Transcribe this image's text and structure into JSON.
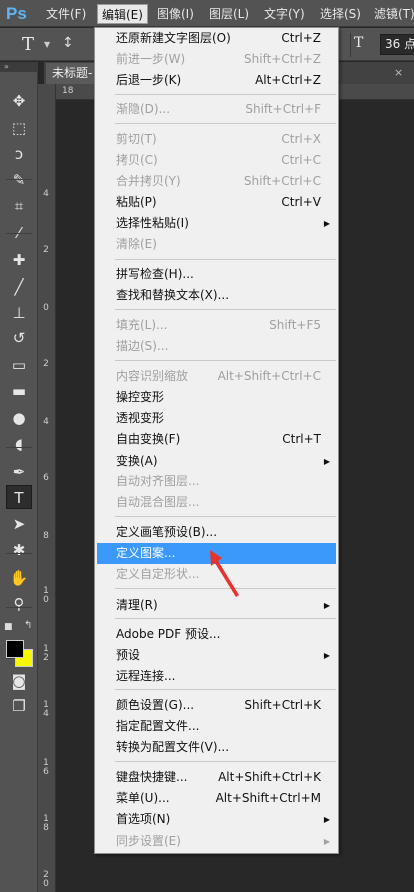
{
  "app": {
    "logo": "Ps"
  },
  "menubar": {
    "items": [
      {
        "label": "文件(F)"
      },
      {
        "label": "编辑(E)"
      },
      {
        "label": "图像(I)"
      },
      {
        "label": "图层(L)"
      },
      {
        "label": "文字(Y)"
      },
      {
        "label": "选择(S)"
      },
      {
        "label": "滤镜(T)"
      }
    ],
    "active_index": 1
  },
  "options_bar": {
    "tool_glyph": "T",
    "font_size_glyph": "T",
    "font_size_value": "36 点"
  },
  "document": {
    "tab_title": "未标题-",
    "tab_close": "×"
  },
  "rulers": {
    "horizontal": [
      "18"
    ],
    "vertical": [
      "4",
      "2",
      "0",
      "2",
      "4",
      "6",
      "8",
      "1 0",
      "1 2",
      "1 4",
      "1 6",
      "1 8",
      "2 0"
    ]
  },
  "colors": {
    "foreground": "#000000",
    "background": "#f7f700",
    "menu_highlight": "#3b99fc",
    "annotation": "#e8322f"
  },
  "edit_menu": {
    "items": [
      {
        "label": "还原新建文字图层(O)",
        "shortcut": "Ctrl+Z",
        "enabled": true,
        "submenu": false
      },
      {
        "label": "前进一步(W)",
        "shortcut": "Shift+Ctrl+Z",
        "enabled": false,
        "submenu": false
      },
      {
        "label": "后退一步(K)",
        "shortcut": "Alt+Ctrl+Z",
        "enabled": true,
        "submenu": false
      },
      {
        "label": "渐隐(D)...",
        "shortcut": "Shift+Ctrl+F",
        "enabled": false,
        "submenu": false
      },
      {
        "label": "剪切(T)",
        "shortcut": "Ctrl+X",
        "enabled": false,
        "submenu": false
      },
      {
        "label": "拷贝(C)",
        "shortcut": "Ctrl+C",
        "enabled": false,
        "submenu": false
      },
      {
        "label": "合并拷贝(Y)",
        "shortcut": "Shift+Ctrl+C",
        "enabled": false,
        "submenu": false
      },
      {
        "label": "粘贴(P)",
        "shortcut": "Ctrl+V",
        "enabled": true,
        "submenu": false
      },
      {
        "label": "选择性粘贴(I)",
        "shortcut": "",
        "enabled": true,
        "submenu": true
      },
      {
        "label": "清除(E)",
        "shortcut": "",
        "enabled": false,
        "submenu": false
      },
      {
        "label": "拼写检查(H)...",
        "shortcut": "",
        "enabled": true,
        "submenu": false
      },
      {
        "label": "查找和替换文本(X)...",
        "shortcut": "",
        "enabled": true,
        "submenu": false
      },
      {
        "label": "填充(L)...",
        "shortcut": "Shift+F5",
        "enabled": false,
        "submenu": false
      },
      {
        "label": "描边(S)...",
        "shortcut": "",
        "enabled": false,
        "submenu": false
      },
      {
        "label": "内容识别缩放",
        "shortcut": "Alt+Shift+Ctrl+C",
        "enabled": false,
        "submenu": false
      },
      {
        "label": "操控变形",
        "shortcut": "",
        "enabled": true,
        "submenu": false
      },
      {
        "label": "透视变形",
        "shortcut": "",
        "enabled": true,
        "submenu": false
      },
      {
        "label": "自由变换(F)",
        "shortcut": "Ctrl+T",
        "enabled": true,
        "submenu": false
      },
      {
        "label": "变换(A)",
        "shortcut": "",
        "enabled": true,
        "submenu": true
      },
      {
        "label": "自动对齐图层...",
        "shortcut": "",
        "enabled": false,
        "submenu": false
      },
      {
        "label": "自动混合图层...",
        "shortcut": "",
        "enabled": false,
        "submenu": false
      },
      {
        "label": "定义画笔预设(B)...",
        "shortcut": "",
        "enabled": true,
        "submenu": false
      },
      {
        "label": "定义图案...",
        "shortcut": "",
        "enabled": true,
        "submenu": false,
        "hover": true
      },
      {
        "label": "定义自定形状...",
        "shortcut": "",
        "enabled": false,
        "submenu": false
      },
      {
        "label": "清理(R)",
        "shortcut": "",
        "enabled": true,
        "submenu": true
      },
      {
        "label": "Adobe PDF 预设...",
        "shortcut": "",
        "enabled": true,
        "submenu": false
      },
      {
        "label": "预设",
        "shortcut": "",
        "enabled": true,
        "submenu": true
      },
      {
        "label": "远程连接...",
        "shortcut": "",
        "enabled": true,
        "submenu": false
      },
      {
        "label": "颜色设置(G)...",
        "shortcut": "Shift+Ctrl+K",
        "enabled": true,
        "submenu": false
      },
      {
        "label": "指定配置文件...",
        "shortcut": "",
        "enabled": true,
        "submenu": false
      },
      {
        "label": "转换为配置文件(V)...",
        "shortcut": "",
        "enabled": true,
        "submenu": false
      },
      {
        "label": "键盘快捷键...",
        "shortcut": "Alt+Shift+Ctrl+K",
        "enabled": true,
        "submenu": false
      },
      {
        "label": "菜单(U)...",
        "shortcut": "Alt+Shift+Ctrl+M",
        "enabled": true,
        "submenu": false
      },
      {
        "label": "首选项(N)",
        "shortcut": "",
        "enabled": true,
        "submenu": true
      },
      {
        "label": "同步设置(E)",
        "shortcut": "",
        "enabled": false,
        "submenu": true
      }
    ]
  },
  "toolbox": {
    "tools": [
      {
        "name": "move-tool",
        "glyph": "✥"
      },
      {
        "name": "marquee-tool",
        "glyph": "⬚"
      },
      {
        "name": "lasso-tool",
        "glyph": "ↄ"
      },
      {
        "name": "quick-selection-tool",
        "glyph": "✎"
      },
      {
        "name": "crop-tool",
        "glyph": "⌗"
      },
      {
        "name": "eyedropper-tool",
        "glyph": "⁄"
      },
      {
        "name": "healing-brush-tool",
        "glyph": "✚"
      },
      {
        "name": "brush-tool",
        "glyph": "╱"
      },
      {
        "name": "clone-stamp-tool",
        "glyph": "⊥"
      },
      {
        "name": "history-brush-tool",
        "glyph": "↺"
      },
      {
        "name": "eraser-tool",
        "glyph": "▭"
      },
      {
        "name": "gradient-tool",
        "glyph": "▬"
      },
      {
        "name": "blur-tool",
        "glyph": "●"
      },
      {
        "name": "dodge-tool",
        "glyph": "◖"
      },
      {
        "name": "pen-tool",
        "glyph": "✒"
      },
      {
        "name": "type-tool",
        "glyph": "T",
        "selected": true
      },
      {
        "name": "path-selection-tool",
        "glyph": "➤"
      },
      {
        "name": "shape-tool",
        "glyph": "✱"
      },
      {
        "name": "hand-tool",
        "glyph": "✋"
      },
      {
        "name": "zoom-tool",
        "glyph": "⚲"
      },
      {
        "name": "quick-mask-tool",
        "glyph": "◙"
      },
      {
        "name": "screen-mode-tool",
        "glyph": "❐"
      }
    ]
  }
}
